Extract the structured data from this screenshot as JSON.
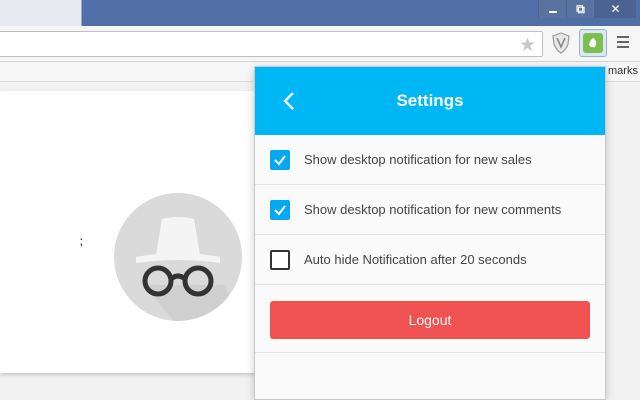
{
  "window": {
    "restore_glyph": "⧉",
    "close_glyph": "✕"
  },
  "toolbar": {
    "star_icon": "star-icon",
    "star_glyph": "★",
    "shield_icon": "shield-icon",
    "extension_icon": "leaf-icon",
    "menu_icon": "hamburger-menu-icon"
  },
  "bookmarks": {
    "label": "marks"
  },
  "incognito": {
    "icon": "incognito-icon",
    "colors": {
      "circle": "#dadada",
      "figure": "#f4f4f4",
      "glasses": "#333333"
    }
  },
  "popup": {
    "title": "Settings",
    "back_icon": "chevron-left-icon",
    "header_color": "#00b7f5",
    "settings": [
      {
        "label": "Show desktop notification for new sales",
        "checked": true
      },
      {
        "label": "Show desktop notification for new comments",
        "checked": true
      },
      {
        "label": "Auto hide Notification after 20 seconds",
        "checked": false
      }
    ],
    "logout": {
      "label": "Logout",
      "color": "#f05151"
    }
  }
}
